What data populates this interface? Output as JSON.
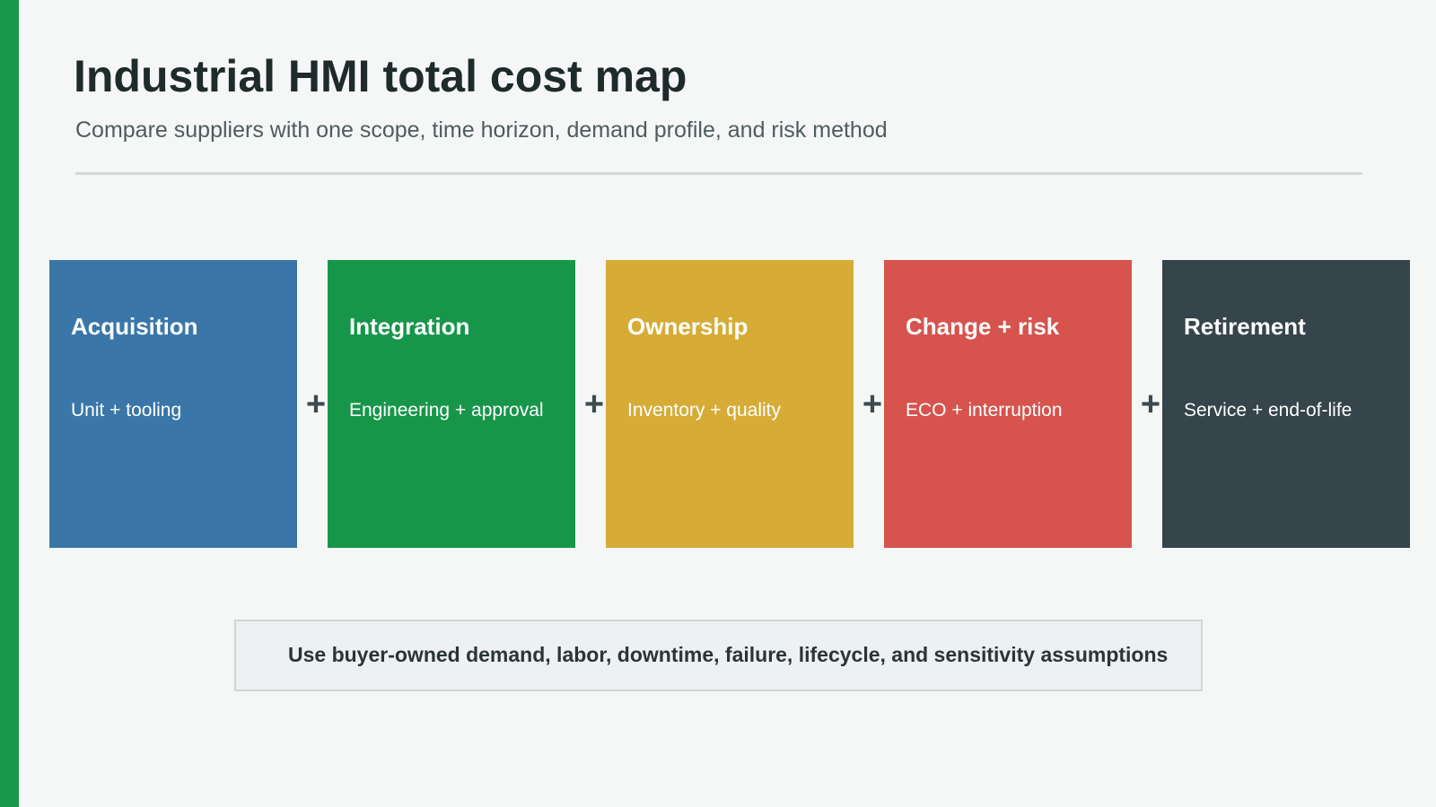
{
  "header": {
    "title": "Industrial HMI total cost map",
    "subtitle": "Compare suppliers with one scope, time horizon, demand profile, and risk method"
  },
  "cards": [
    {
      "label": "Acquisition",
      "detail": "Unit + tooling",
      "color": "#3a77a8"
    },
    {
      "label": "Integration",
      "detail": "Engineering + approval",
      "color": "#17964a"
    },
    {
      "label": "Ownership",
      "detail": "Inventory + quality",
      "color": "#d6ac37"
    },
    {
      "label": "Change + risk",
      "detail": "ECO + interruption",
      "color": "#d6534e"
    },
    {
      "label": "Retirement",
      "detail": "Service + end-of-life",
      "color": "#36444b"
    }
  ],
  "operator": "+",
  "footer": {
    "note": "Use buyer-owned demand, labor, downtime, failure, lifecycle, and sensitivity assumptions"
  },
  "colors": {
    "accent_bar": "#17984a",
    "background": "#f5f7f7"
  }
}
